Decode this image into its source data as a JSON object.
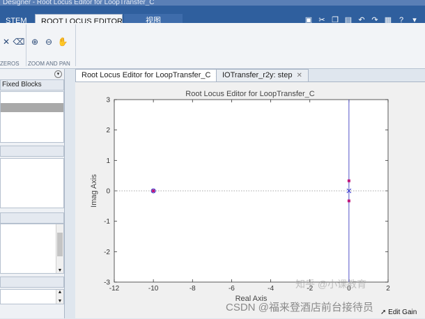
{
  "window": {
    "title": "Designer - Root Locus Editor for LoopTransfer_C"
  },
  "ribbon": {
    "tabs": [
      {
        "label": "STEM",
        "active": false
      },
      {
        "label": "ROOT LOCUS EDITOR",
        "active": true
      },
      {
        "label": "视图",
        "active": false
      }
    ],
    "sections": {
      "zeros": "ZEROS",
      "zoom_and_pan": "ZOOM AND PAN"
    }
  },
  "left_panel": {
    "header1": "Fixed Blocks"
  },
  "doc_tabs": [
    {
      "label": "Root Locus Editor for LoopTransfer_C",
      "active": true
    },
    {
      "label": "IOTransfer_r2y: step",
      "active": false
    }
  ],
  "chart_data": {
    "type": "scatter",
    "title": "Root Locus Editor for LoopTransfer_C",
    "xlabel": "Real Axis",
    "ylabel": "Imag Axis",
    "xlim": [
      -12,
      2
    ],
    "ylim": [
      -3,
      3
    ],
    "xticks": [
      -12,
      -10,
      -8,
      -6,
      -4,
      -2,
      0,
      2
    ],
    "yticks": [
      -3,
      -2,
      -1,
      0,
      1,
      2,
      3
    ],
    "grid": false,
    "asymptote_x": 0,
    "poles": [
      {
        "x": 0,
        "y": 0
      }
    ],
    "zeros": [
      {
        "x": -10,
        "y": 0
      }
    ],
    "closed_loop_poles": [
      {
        "x": -10,
        "y": 0
      },
      {
        "x": 0,
        "y": 0.33
      },
      {
        "x": 0,
        "y": -0.33
      }
    ],
    "colors": {
      "locus": "#4040c0",
      "pole": "#3333cc",
      "closed_loop": "#c0157a",
      "axis_dotted": "#8a8a8a"
    }
  },
  "watermarks": {
    "zhihu": "知乎 @小课教育",
    "csdn": "CSDN @福来登酒店前台接待员"
  },
  "status": {
    "edit_gain": "Edit Gain"
  }
}
